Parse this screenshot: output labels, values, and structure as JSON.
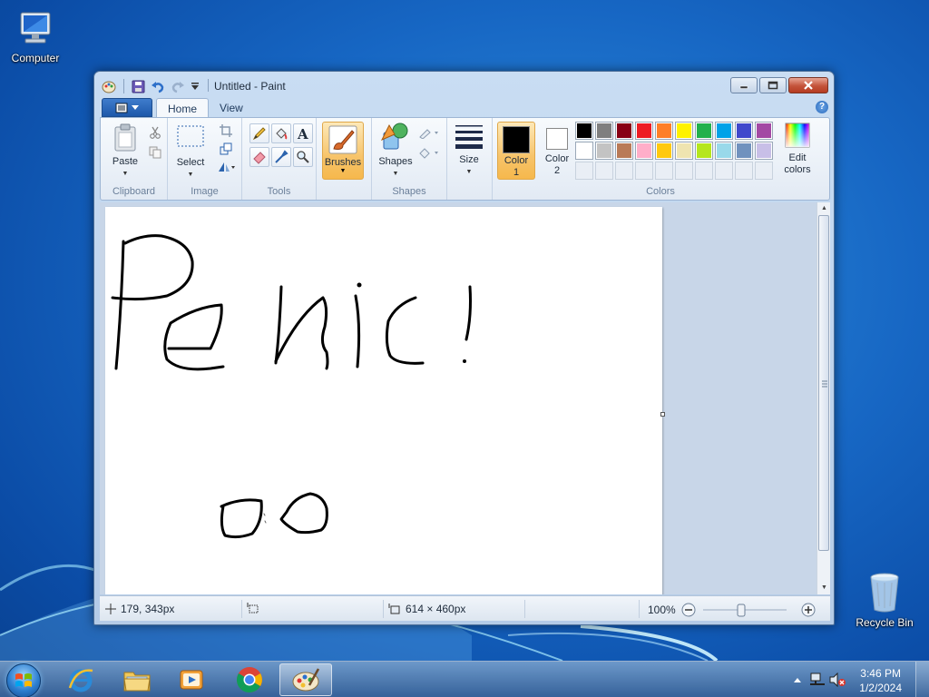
{
  "desktop": {
    "icons": [
      {
        "label": "Computer",
        "icon": "computer-icon"
      },
      {
        "label": "Recycle Bin",
        "icon": "recycle-bin-icon"
      }
    ]
  },
  "window": {
    "title": "Untitled - Paint",
    "tabs": [
      {
        "label": "Home",
        "active": true
      },
      {
        "label": "View",
        "active": false
      }
    ]
  },
  "ribbon": {
    "clipboard": {
      "paste_label": "Paste",
      "group_label": "Clipboard"
    },
    "image": {
      "select_label": "Select",
      "group_label": "Image"
    },
    "tools": {
      "group_label": "Tools"
    },
    "brushes": {
      "label": "Brushes"
    },
    "shapes": {
      "shapes_label": "Shapes",
      "group_label": "Shapes"
    },
    "size": {
      "label": "Size"
    },
    "colors": {
      "color1_label": "Color",
      "color1_num": "1",
      "color2_label": "Color",
      "color2_num": "2",
      "edit_label": "Edit",
      "edit_label2": "colors",
      "group_label": "Colors",
      "color1_value": "#000000",
      "color2_value": "#ffffff",
      "palette": [
        "#000000",
        "#7f7f7f",
        "#880015",
        "#ed1c24",
        "#ff7f27",
        "#fff200",
        "#22b14c",
        "#00a2e8",
        "#3f48cc",
        "#a349a4",
        "#ffffff",
        "#c3c3c3",
        "#b97a57",
        "#ffaec9",
        "#ffc90e",
        "#efe4b0",
        "#b5e61d",
        "#99d9ea",
        "#7092be",
        "#c8bfe7"
      ]
    }
  },
  "canvas": {
    "drawing_text": "Panic!"
  },
  "status": {
    "cursor_pos": "179, 343px",
    "selection_size": "",
    "image_size": "614 × 460px",
    "zoom": "100%"
  },
  "taskbar": {
    "apps": [
      "start-orb",
      "internet-explorer",
      "file-explorer",
      "media-player",
      "chrome",
      "paint"
    ],
    "time": "3:46 PM",
    "date": "1/2/2024"
  }
}
